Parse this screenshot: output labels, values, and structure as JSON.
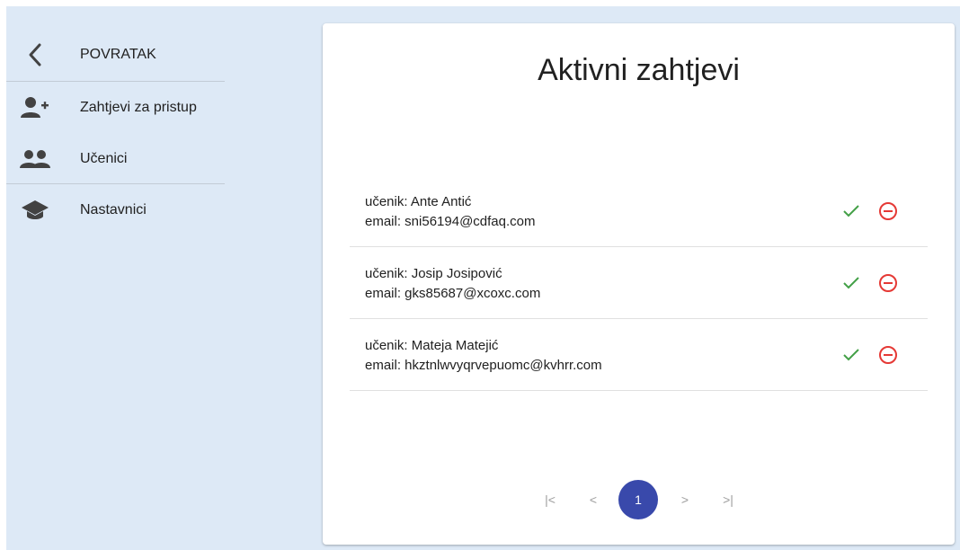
{
  "sidebar": {
    "items": [
      {
        "label": "POVRATAK",
        "icon": "chevron-left-icon"
      },
      {
        "label": "Zahtjevi za pristup",
        "icon": "person-add-icon"
      },
      {
        "label": "Učenici",
        "icon": "group-icon"
      },
      {
        "label": "Nastavnici",
        "icon": "school-icon"
      }
    ]
  },
  "main": {
    "title": "Aktivni zahtjevi",
    "requests": [
      {
        "student": "učenik: Ante Antić",
        "email": "email: sni56194@cdfaq.com"
      },
      {
        "student": "učenik: Josip Josipović",
        "email": "email: gks85687@xcoxc.com"
      },
      {
        "student": "učenik: Mateja Matejić",
        "email": "email: hkztnlwvyqrvepuomc@kvhrr.com"
      }
    ],
    "pagination": {
      "first": "|<",
      "prev": "<",
      "current": "1",
      "next": ">",
      "last": ">|"
    }
  },
  "colors": {
    "background": "#dde9f6",
    "approve": "#43a047",
    "reject": "#e53935",
    "page_active": "#3949ab",
    "icon": "#424242"
  }
}
